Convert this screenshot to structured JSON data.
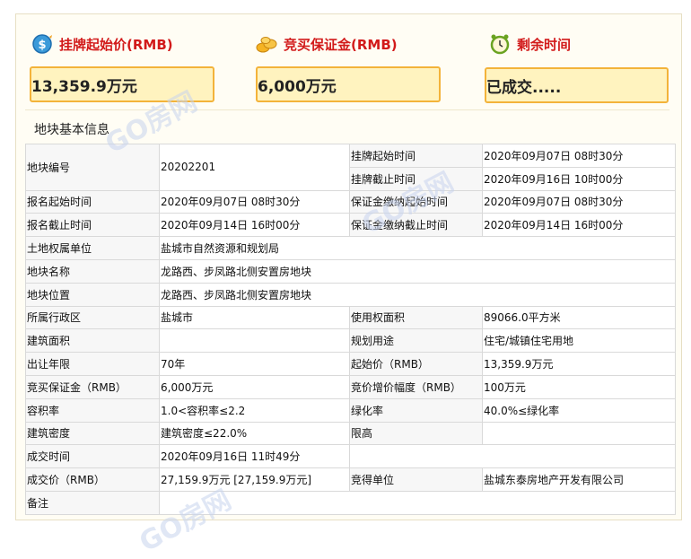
{
  "header": {
    "start_price_label": "挂牌起始价(RMB)",
    "deposit_label": "竞买保证金(RMB)",
    "time_label": "剩余时间",
    "start_price_value": "13,359.9万元",
    "deposit_value": "6,000万元",
    "time_value": "已成交....."
  },
  "section_title": "地块基本信息",
  "watermark": "GO房网",
  "table": {
    "r1": {
      "l1": "地块编号",
      "v1": "20202201",
      "l2a": "挂牌起始时间",
      "v2a": "2020年09月07日 08时30分",
      "l2b": "挂牌截止时间",
      "v2b": "2020年09月16日 10时00分"
    },
    "r2": {
      "l1": "报名起始时间",
      "v1": "2020年09月07日 08时30分",
      "l2": "保证金缴纳起始时间",
      "v2": "2020年09月07日 08时30分"
    },
    "r3": {
      "l1": "报名截止时间",
      "v1": "2020年09月14日 16时00分",
      "l2": "保证金缴纳截止时间",
      "v2": "2020年09月14日 16时00分"
    },
    "r4": {
      "l1": "土地权属单位",
      "v1": "盐城市自然资源和规划局"
    },
    "r5": {
      "l1": "地块名称",
      "v1": "龙路西、步凤路北侧安置房地块"
    },
    "r6": {
      "l1": "地块位置",
      "v1": "龙路西、步凤路北侧安置房地块"
    },
    "r7": {
      "l1": "所属行政区",
      "v1": "盐城市",
      "l2": "使用权面积",
      "v2": "89066.0平方米"
    },
    "r8": {
      "l1": "建筑面积",
      "v1": "",
      "l2": "规划用途",
      "v2": "住宅/城镇住宅用地"
    },
    "r9": {
      "l1": "出让年限",
      "v1": "70年",
      "l2": "起始价（RMB）",
      "v2": "13,359.9万元"
    },
    "r10": {
      "l1": "竞买保证金（RMB）",
      "v1": "6,000万元",
      "l2": "竞价增价幅度（RMB）",
      "v2": "100万元"
    },
    "r11": {
      "l1": "容积率",
      "v1": "1.0<容积率≤2.2",
      "l2": "绿化率",
      "v2": "40.0%≤绿化率"
    },
    "r12": {
      "l1": "建筑密度",
      "v1": "建筑密度≤22.0%",
      "l2": "限高",
      "v2": ""
    },
    "r13": {
      "l1": "成交时间",
      "v1": "2020年09月16日 11时49分"
    },
    "r14": {
      "l1": "成交价（RMB）",
      "v1": "27,159.9万元 [27,159.9万元]",
      "l2": "竞得单位",
      "v2": "盐城东泰房地产开发有限公司"
    },
    "r15": {
      "l1": "备注",
      "v1": ""
    }
  }
}
